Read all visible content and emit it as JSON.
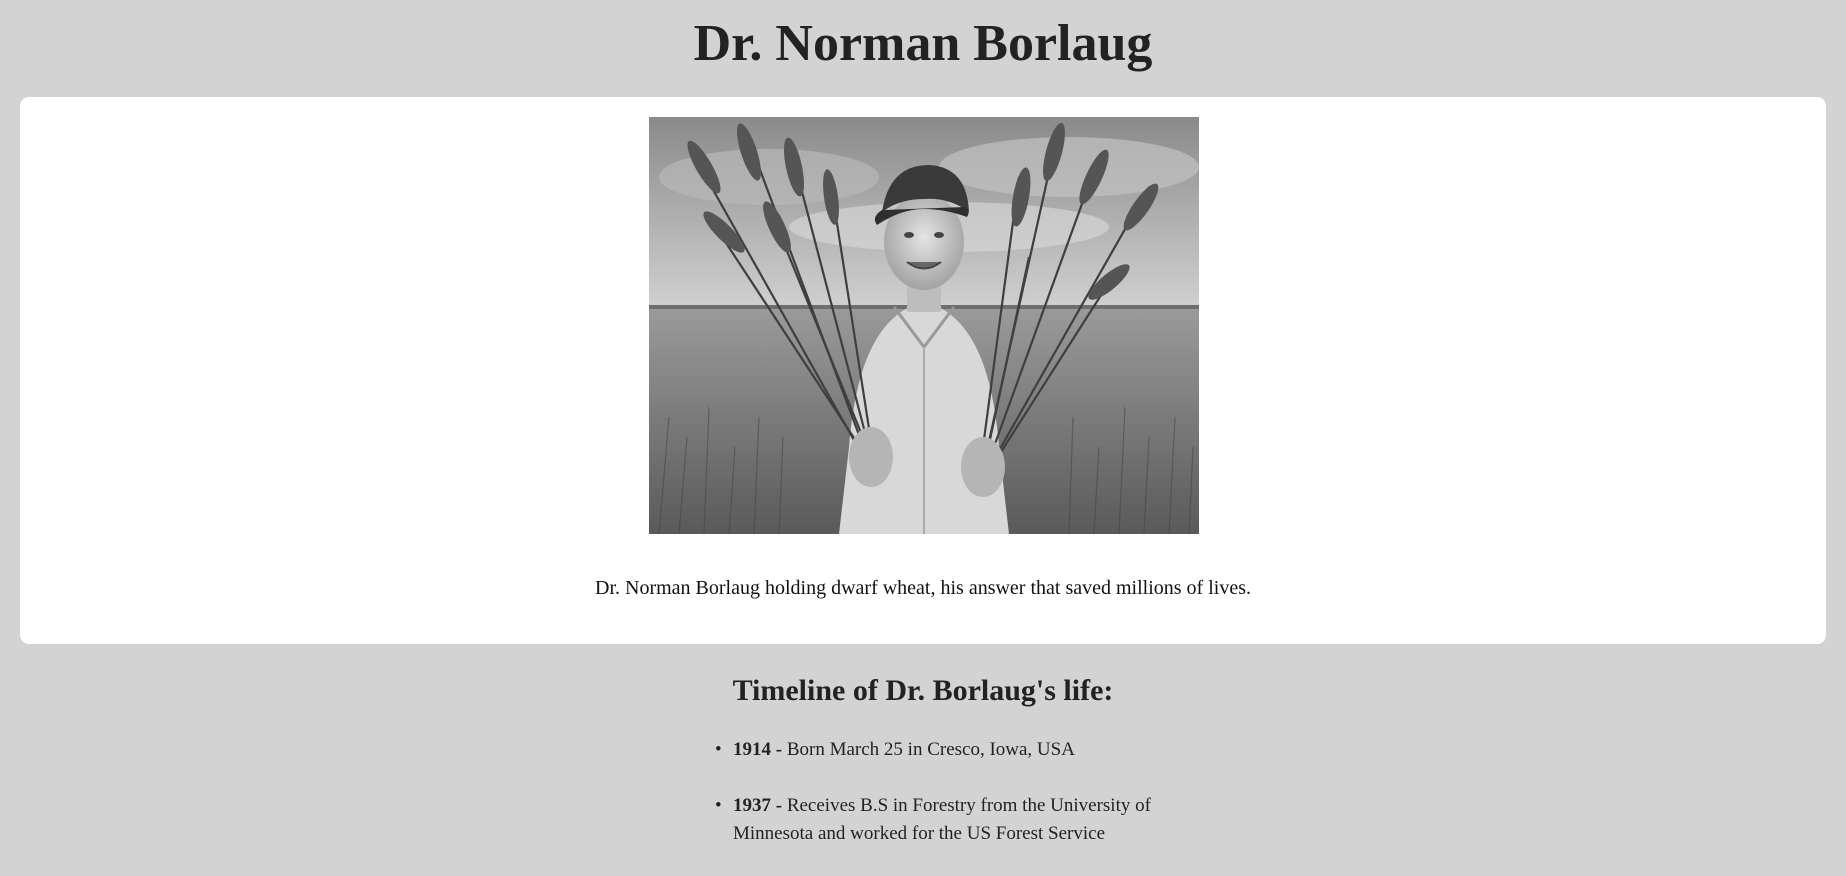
{
  "page": {
    "title": "Dr. Norman Borlaug"
  },
  "figure": {
    "image_alt": "Black and white photo of a man in a cap holding two bundles of wheat in a field",
    "caption": "Dr. Norman Borlaug holding dwarf wheat, his answer that saved millions of lives."
  },
  "timeline": {
    "heading": "Timeline of Dr. Borlaug's life:",
    "items": [
      {
        "year": "1914",
        "separator": " - ",
        "text": "Born March 25 in Cresco, Iowa, USA"
      },
      {
        "year": "1937",
        "separator": " - ",
        "text": "Receives B.S in Forestry from the University of Minnesota and worked for the US Forest Service"
      }
    ]
  },
  "colors": {
    "page_background": "#d3d3d3",
    "card_background": "#ffffff",
    "text": "#222222"
  }
}
